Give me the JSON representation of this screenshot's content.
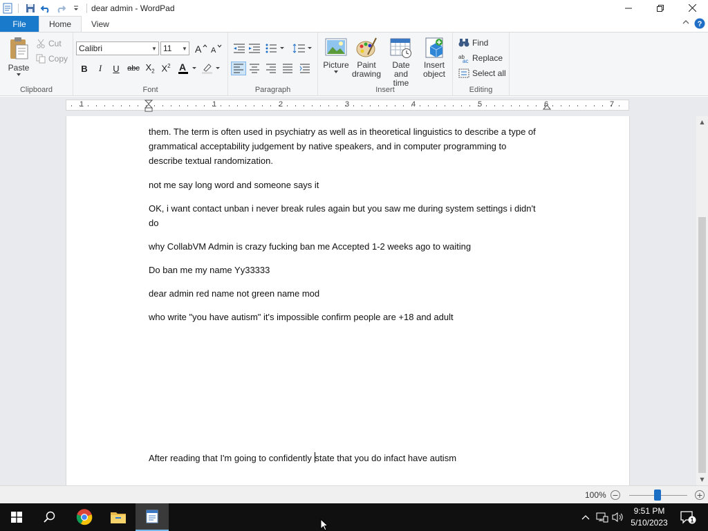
{
  "window": {
    "title": "dear admin - WordPad",
    "minimize_icon": "minimize-icon",
    "maximize_icon": "restore-icon",
    "close_icon": "close-icon"
  },
  "quick_access": {
    "icons": [
      "wordpad-app-icon",
      "save-icon",
      "undo-icon",
      "redo-icon",
      "customize-dropdown-icon"
    ]
  },
  "tabs": {
    "file": "File",
    "home": "Home",
    "view": "View"
  },
  "ribbon": {
    "clipboard": {
      "label": "Clipboard",
      "paste": "Paste",
      "cut": "Cut",
      "copy": "Copy"
    },
    "font": {
      "label": "Font",
      "family": "Calibri",
      "size": "11"
    },
    "paragraph": {
      "label": "Paragraph"
    },
    "insert": {
      "label": "Insert",
      "picture": "Picture",
      "paint_drawing_line1": "Paint",
      "paint_drawing_line2": "drawing",
      "date_time_line1": "Date and",
      "date_time_line2": "time",
      "insert_object_line1": "Insert",
      "insert_object_line2": "object"
    },
    "editing": {
      "label": "Editing",
      "find": "Find",
      "replace": "Replace",
      "select_all": "Select all"
    }
  },
  "ruler": {
    "numbers": [
      "1",
      "1",
      "2",
      "3",
      "4",
      "5",
      "6",
      "7"
    ]
  },
  "document": {
    "paragraphs": [
      "them. The term is often used in psychiatry as well as in theoretical linguistics to describe a type of grammatical acceptability judgement by native speakers, and in computer programming to describe textual randomization.",
      "not me say long word and someone says it",
      "OK, i want contact unban i never break rules again but you saw me during system settings i didn't do",
      "why CollabVM Admin is crazy fucking ban me Accepted 1-2 weeks ago to waiting",
      "Do ban me my name Yy33333",
      "dear admin red name not green name mod",
      "who write \"you have autism\" it's impossible confirm people are +18 and adult"
    ],
    "last_before_caret": "After reading that I'm going to confidently ",
    "last_after_caret": "state that you do infact have autism"
  },
  "statusbar": {
    "zoom": "100%",
    "zoom_out": "−",
    "zoom_in": "+"
  },
  "taskbar": {
    "time": "9:51 PM",
    "date": "5/10/2023",
    "notification_count": "1"
  },
  "colors": {
    "file_tab": "#1979ca",
    "taskbar": "#101010",
    "zoom_thumb": "#1a6fc4"
  }
}
